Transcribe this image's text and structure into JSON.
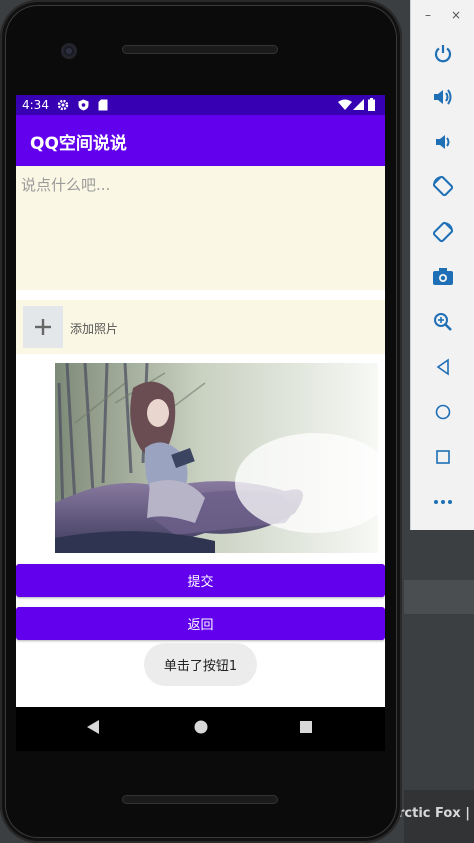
{
  "toolbar": {
    "minimize": "–",
    "close": "×",
    "icons": [
      "power-icon",
      "volume-up-icon",
      "volume-down-icon",
      "rotate-left-icon",
      "rotate-right-icon",
      "camera-icon",
      "zoom-icon",
      "back-icon",
      "home-icon",
      "overview-icon",
      "more-icon"
    ]
  },
  "ide": {
    "text": "rctic Fox |"
  },
  "status_bar": {
    "time": "4:34",
    "icons": [
      "settings-icon",
      "shield-icon",
      "sd-card-icon",
      "wifi-icon",
      "signal-icon",
      "battery-icon"
    ]
  },
  "app": {
    "title": "QQ空间说说"
  },
  "post": {
    "placeholder": "说点什么吧..."
  },
  "add_photo": {
    "label": "添加照片",
    "icon": "plus-icon"
  },
  "buttons": {
    "submit": "提交",
    "back": "返回"
  },
  "toast": {
    "message": "单击了按钮1"
  },
  "nav": {
    "icons": [
      "back-triangle-icon",
      "home-circle-icon",
      "recents-square-icon"
    ]
  },
  "colors": {
    "primary": "#6200ee",
    "primary_dark": "#3700b3",
    "input_background": "#faf7e4",
    "toolbar_icon": "#1e6fb5"
  }
}
